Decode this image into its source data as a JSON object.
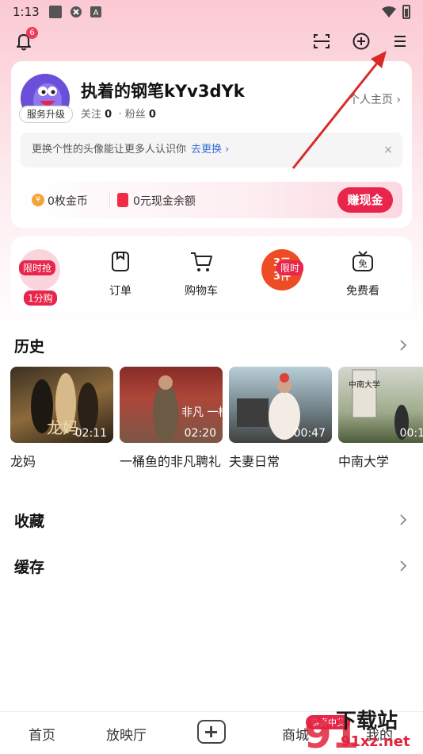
{
  "status_bar": {
    "time": "1:13"
  },
  "top_bar": {
    "notification_count": "6"
  },
  "profile": {
    "username": "执着的钢笔kYv3dYk",
    "service_badge": "服务升级",
    "following_label": "关注",
    "following_count": "0",
    "followers_label": "· 粉丝",
    "followers_count": "0",
    "homepage_link": "个人主页 ›"
  },
  "tip": {
    "text": "更换个性的头像能让更多人认识你",
    "link": "去更换 ›",
    "close": "×"
  },
  "wallet": {
    "coin_symbol": "¥",
    "coins": "0枚金币",
    "cash": "0元现金余额",
    "earn_button": "赚现金"
  },
  "shortcuts": {
    "flash_tag": "限时抢",
    "flash_sub": "1分购",
    "orders": "订单",
    "cart": "购物车",
    "deal_tag": "限时",
    "deal_line1": "3元",
    "deal_line2": "3件",
    "free_icon": "免",
    "free_watch": "免费看"
  },
  "history": {
    "title": "历史",
    "items": [
      {
        "title": "龙妈",
        "duration": "02:11",
        "poster_text": "龙妈"
      },
      {
        "title": "一桶鱼的非凡聘礼",
        "duration": "02:20",
        "poster_text": "非凡 一桶鱼"
      },
      {
        "title": "夫妻日常",
        "duration": "00:47",
        "poster_text": ""
      },
      {
        "title": "中南大学",
        "duration": "00:1",
        "poster_text": "中南大学"
      }
    ]
  },
  "favorites": {
    "title": "收藏"
  },
  "cache": {
    "title": "缓存"
  },
  "bottom_nav": {
    "home": "首页",
    "theater": "放映厅",
    "mall": "商城",
    "mall_badge": "恭喜中奖",
    "mine": "我的"
  },
  "watermark": {
    "text": "下载站",
    "url": "91xz.net",
    "logo": "91"
  },
  "colors": {
    "accent": "#e8254a",
    "link": "#3a6fd8",
    "header_gradient_top": "#fbc9d3",
    "arrow": "#d92a2a"
  }
}
